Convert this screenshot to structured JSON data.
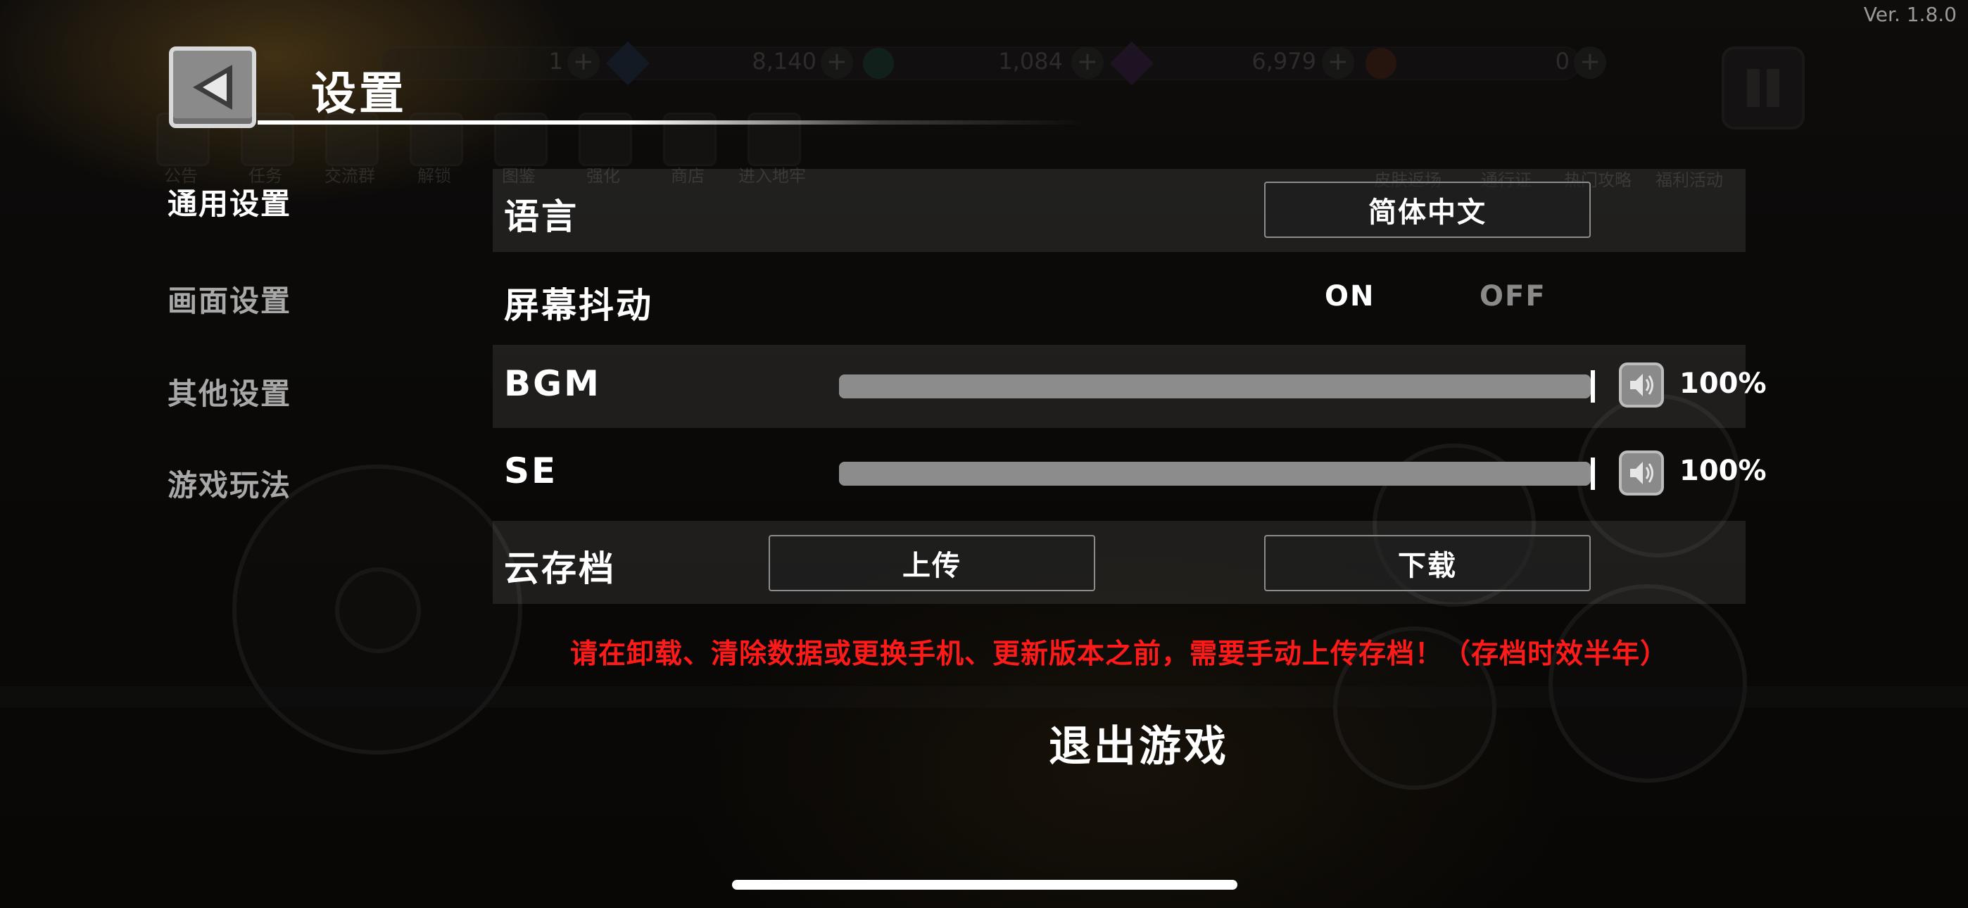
{
  "version": "Ver. 1.8.0",
  "header": {
    "title": "设置"
  },
  "background_hud": {
    "currencies": [
      "1",
      "8,140",
      "1,084",
      "6,979",
      "0"
    ],
    "menu": [
      "公告",
      "任务",
      "交流群",
      "解锁",
      "图鉴",
      "强化",
      "商店",
      "进入地牢"
    ],
    "right_menu": [
      "皮肤返场",
      "通行证",
      "热门攻略",
      "福利活动"
    ]
  },
  "tabs": [
    {
      "label": "通用设置",
      "active": true
    },
    {
      "label": "画面设置",
      "active": false
    },
    {
      "label": "其他设置",
      "active": false
    },
    {
      "label": "游戏玩法",
      "active": false
    }
  ],
  "settings": {
    "language": {
      "label": "语言",
      "value": "简体中文"
    },
    "screen_shake": {
      "label": "屏幕抖动",
      "on": "ON",
      "off": "OFF",
      "selected": "ON"
    },
    "bgm": {
      "label": "BGM",
      "level": 1.0,
      "percent": "100%"
    },
    "se": {
      "label": "SE",
      "level": 1.0,
      "percent": "100%"
    },
    "cloud_save": {
      "label": "云存档",
      "upload": "上传",
      "download": "下载"
    }
  },
  "warning": "请在卸载、清除数据或更换手机、更新版本之前，需要手动上传存档！（存档时效半年）",
  "exit_label": "退出游戏",
  "colors": {
    "warning": "#ff1a1a",
    "toggle_on": "#ffffff",
    "toggle_off": "#8a8a8a"
  },
  "icons": [
    "back-arrow-icon",
    "speaker-icon"
  ]
}
